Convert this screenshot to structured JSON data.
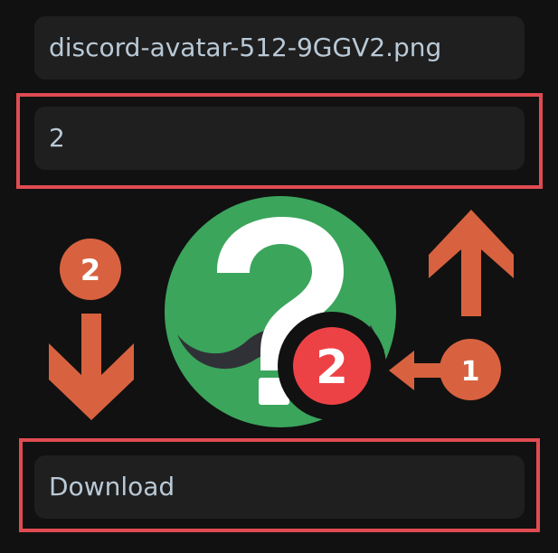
{
  "filename_field": {
    "value": "discord-avatar-512-9GGV2.png"
  },
  "size_field": {
    "value": "2"
  },
  "download_button": {
    "label": "Download"
  },
  "annotations": {
    "left_badge": "2",
    "avatar_badge": "2",
    "right_badge": "1"
  },
  "colors": {
    "background": "#111111",
    "field_bg": "#1f1f20",
    "field_text": "#b9c9d6",
    "highlight": "#e04b52",
    "arrow": "#d8623f",
    "avatar_green": "#3ba55c",
    "avatar_badge": "#ed4245"
  },
  "icons": {
    "avatar": "discord-default-avatar-icon",
    "up_arrow": "arrow-up-icon",
    "down_arrow": "arrow-down-icon",
    "left_arrow": "arrow-left-icon"
  }
}
